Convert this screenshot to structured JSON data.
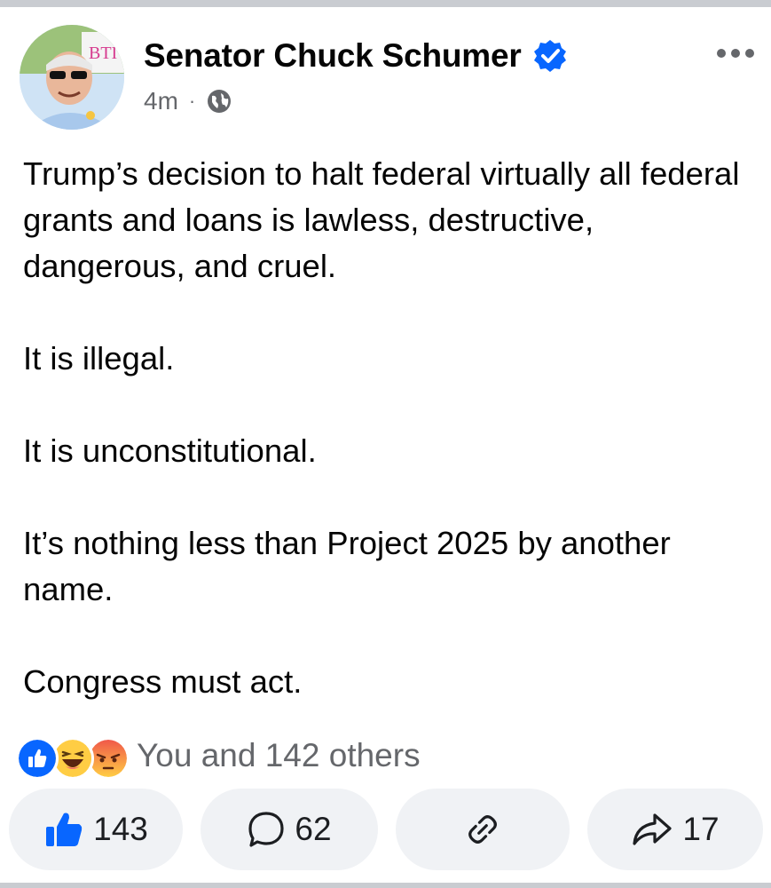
{
  "post": {
    "author": "Senator Chuck Schumer",
    "timestamp": "4m",
    "separator": "·",
    "paragraphs": [
      "Trump’s decision to halt federal virtually all federal grants and loans is lawless, destructive, dangerous, and cruel.",
      "It is illegal.",
      "It is unconstitutional.",
      "It’s nothing less than Project 2025 by another name.",
      "Congress must act."
    ],
    "avatar_sign_text": "BTI"
  },
  "reactions": {
    "summary": "You and 142 others",
    "icons": [
      "like-reaction-icon",
      "haha-reaction-icon",
      "angry-reaction-icon"
    ]
  },
  "actions": {
    "like_count": "143",
    "comment_count": "62",
    "share_count": "17"
  },
  "colors": {
    "brand_blue": "#0866ff",
    "secondary_text": "#65676b",
    "button_bg": "#f0f2f5",
    "angry_orange": "#f0584a",
    "haha_yellow": "#ffcd44"
  }
}
